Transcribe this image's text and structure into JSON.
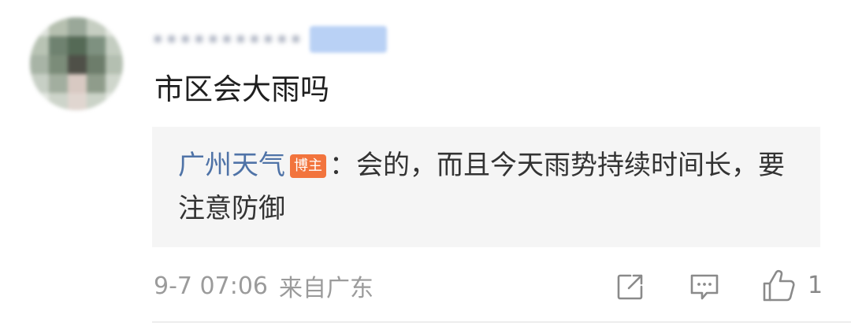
{
  "comment": {
    "author_name": "•••••••••••",
    "text": "市区会大雨吗",
    "reply": {
      "author": "广州天气",
      "badge": "博主",
      "separator": "：",
      "text": "会的，而且今天雨势持续时间长，要注意防御"
    },
    "meta": {
      "timestamp": "9-7 07:06",
      "location": "来自广东"
    },
    "actions": {
      "share_icon": "share-icon",
      "reply_icon": "comment-icon",
      "like_icon": "thumbs-up-icon",
      "like_count": "1"
    }
  },
  "colors": {
    "author_link": "#4f73a7",
    "badge_bg": "#f2743d",
    "reply_bg": "#f5f5f5",
    "meta_text": "#9b9b9b"
  }
}
